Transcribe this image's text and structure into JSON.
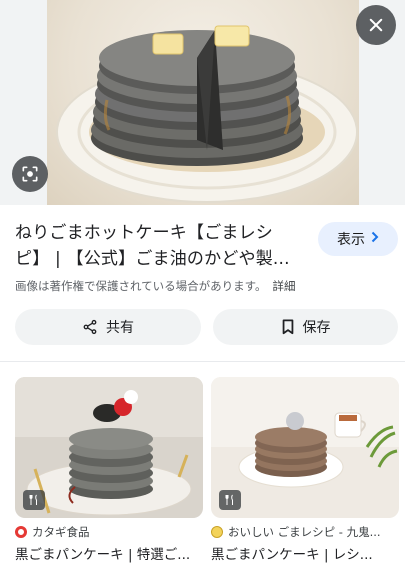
{
  "result": {
    "title": "ねりごまホットケーキ【ごまレシピ】 | 【公式】ごま油のかどや製...",
    "visit_label": "表示",
    "copyright_notice": "画像は著作権で保護されている場合があります。",
    "detail_link": "詳細",
    "share_label": "共有",
    "save_label": "保存"
  },
  "related": [
    {
      "source": "カタギ食品",
      "title": "黒ごまパンケーキ | 特選ご...",
      "favicon_color": "#e53935"
    },
    {
      "source": "おいしい ごまレシピ - 九鬼...",
      "title": "黒ごまパンケーキ | レシ...",
      "favicon_color": "#c9a227"
    }
  ],
  "icons": {
    "close": "close-icon",
    "lens": "lens-icon",
    "share": "share-icon",
    "save": "bookmark-icon",
    "recipe": "fork-knife-icon",
    "visit": "chevron-right-icon"
  }
}
